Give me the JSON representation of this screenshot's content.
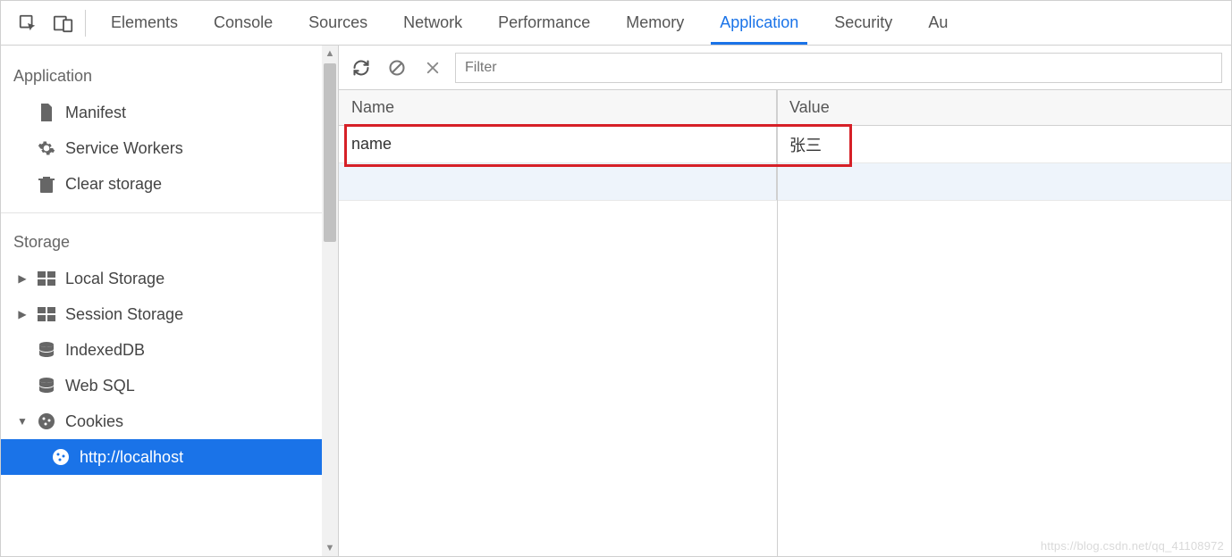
{
  "tabs": {
    "items": [
      "Elements",
      "Console",
      "Sources",
      "Network",
      "Performance",
      "Memory",
      "Application",
      "Security",
      "Au"
    ],
    "activeIndex": 6
  },
  "sidebar": {
    "sections": {
      "application": {
        "header": "Application",
        "items": [
          {
            "label": "Manifest"
          },
          {
            "label": "Service Workers"
          },
          {
            "label": "Clear storage"
          }
        ]
      },
      "storage": {
        "header": "Storage",
        "items": [
          {
            "label": "Local Storage",
            "caret": "right"
          },
          {
            "label": "Session Storage",
            "caret": "right"
          },
          {
            "label": "IndexedDB"
          },
          {
            "label": "Web SQL"
          },
          {
            "label": "Cookies",
            "caret": "down"
          }
        ],
        "cookies_child": {
          "label": "http://localhost"
        }
      }
    }
  },
  "toolbar": {
    "filter_placeholder": "Filter"
  },
  "table": {
    "columns": {
      "name": "Name",
      "value": "Value"
    },
    "rows": [
      {
        "name": "name",
        "value": "张三"
      }
    ]
  },
  "watermark": "https://blog.csdn.net/qq_41108972"
}
